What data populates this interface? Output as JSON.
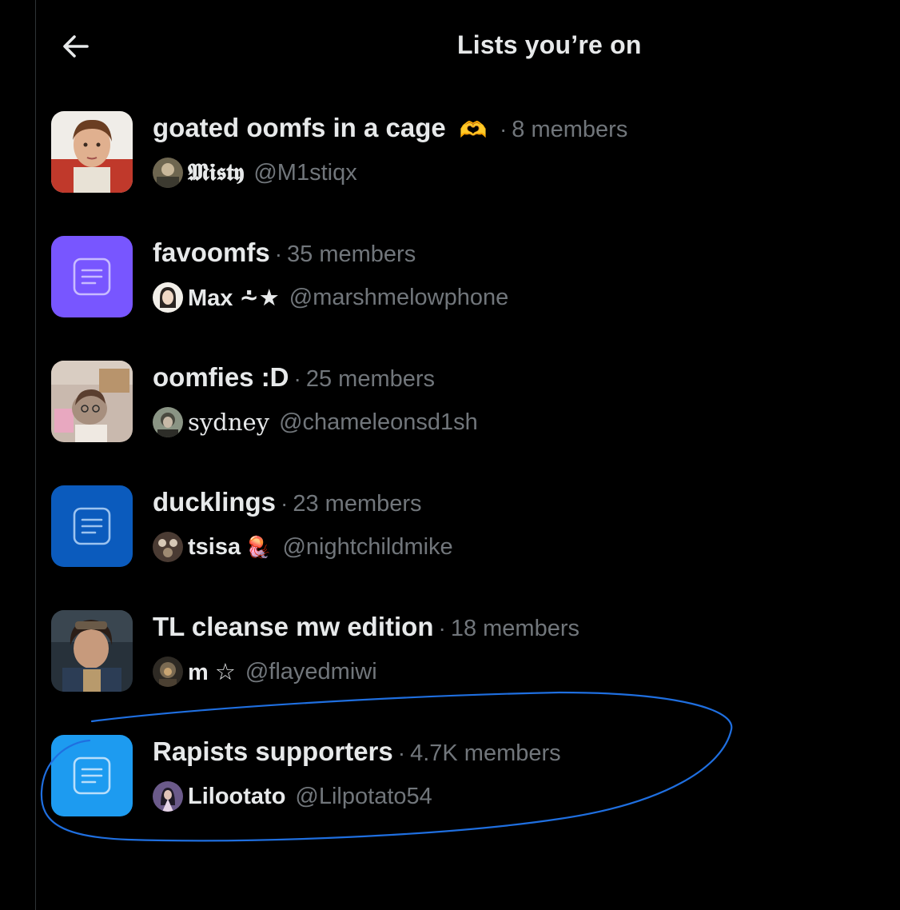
{
  "header": {
    "title": "Lists you’re on"
  },
  "lists": [
    {
      "name": "goated oomfs in a cage",
      "name_emoji": "🫶",
      "separator": "·",
      "members": "8 members",
      "owner_name": "𝕸𝖎𝖘𝖙𝖞",
      "owner_handle": "@M1stiqx"
    },
    {
      "name": "favoomfs",
      "separator": "·",
      "members": "35 members",
      "owner_name": "Max ⩪★",
      "owner_handle": "@marshmelowphone"
    },
    {
      "name": "oomfies :D",
      "separator": "·",
      "members": "25 members",
      "owner_name": "sydney",
      "owner_handle": "@chameleonsd1sh"
    },
    {
      "name": "ducklings",
      "separator": "·",
      "members": "23 members",
      "owner_name": "tsisa",
      "owner_emoji": "🪼",
      "owner_handle": "@nightchildmike"
    },
    {
      "name": "TL cleanse mw edition",
      "separator": "·",
      "members": "18 members",
      "owner_name": "m ☆",
      "owner_handle": "@flayedmiwi"
    },
    {
      "name": "Rapists supporters",
      "separator": "·",
      "members": "4.7K members",
      "owner_name": "Lilootato",
      "owner_handle": "@Lilpotato54"
    }
  ],
  "colors": {
    "background": "#000000",
    "text_primary": "#e7e9ea",
    "text_secondary": "#71767b",
    "purple_list": "#7856ff",
    "navy_list": "#0b5bbd",
    "blue_list": "#1d9bf0",
    "annotation_stroke": "#1f6fe0"
  },
  "icons": {
    "back": "arrow-left-icon",
    "list": "list-document-icon"
  }
}
